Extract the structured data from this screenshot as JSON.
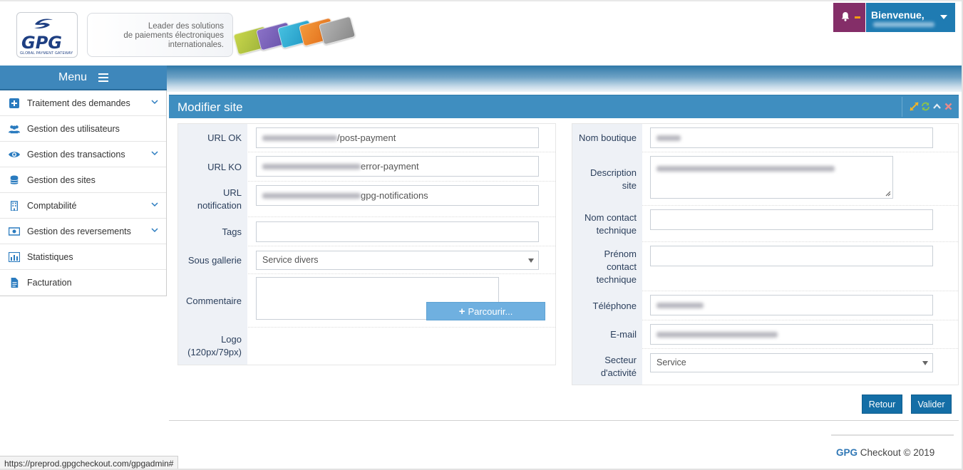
{
  "header": {
    "logo_text": "GPG",
    "logo_sub": "GLOBAL PAYMENT GATEWAY",
    "tagline": [
      "Leader des solutions",
      "de paiements électroniques",
      "internationales."
    ],
    "welcome": "Bienvenue,"
  },
  "menu": {
    "title": "Menu",
    "items": [
      {
        "label": "Traitement des demandes",
        "icon": "plus-square-icon",
        "expandable": true
      },
      {
        "label": "Gestion des utilisateurs",
        "icon": "users-icon",
        "expandable": false
      },
      {
        "label": "Gestion des transactions",
        "icon": "eye-icon",
        "expandable": true
      },
      {
        "label": "Gestion des sites",
        "icon": "database-icon",
        "expandable": false
      },
      {
        "label": "Comptabilité",
        "icon": "building-icon",
        "expandable": true
      },
      {
        "label": "Gestion des reversements",
        "icon": "money-icon",
        "expandable": true
      },
      {
        "label": "Statistiques",
        "icon": "bar-chart-icon",
        "expandable": false
      },
      {
        "label": "Facturation",
        "icon": "file-icon",
        "expandable": false
      }
    ]
  },
  "panel": {
    "title": "Modifier site"
  },
  "left_form": {
    "url_ok": {
      "label": "URL OK",
      "value": "/post-payment"
    },
    "url_ko": {
      "label": "URL KO",
      "value": "error-payment"
    },
    "url_notification": {
      "label_1": "URL",
      "label_2": "notification",
      "value": "gpg-notifications"
    },
    "tags": {
      "label": "Tags",
      "value": ""
    },
    "sous_gallerie": {
      "label": "Sous gallerie",
      "value": "Service divers"
    },
    "commentaire": {
      "label": "Commentaire",
      "value": ""
    },
    "logo": {
      "label_1": "Logo",
      "label_2": "(120px/79px)",
      "button": "Parcourir..."
    }
  },
  "right_form": {
    "nom_boutique": {
      "label": "Nom boutique"
    },
    "description": {
      "label_1": "Description",
      "label_2": "site"
    },
    "nom_contact": {
      "label_1": "Nom contact",
      "label_2": "technique",
      "value": ""
    },
    "prenom_contact": {
      "label_1": "Prénom",
      "label_2": "contact",
      "label_3": "technique",
      "value": ""
    },
    "telephone": {
      "label": "Téléphone"
    },
    "email": {
      "label": "E-mail"
    },
    "secteur": {
      "label_1": "Secteur",
      "label_2": "d'activité",
      "value": "Service"
    }
  },
  "actions": {
    "back": "Retour",
    "submit": "Valider"
  },
  "footer": {
    "brand": "GPG",
    "text": " Checkout © 2019"
  },
  "status_url": "https://preprod.gpgcheckout.com/gpgadmin#",
  "colors": {
    "primary": "#146ea6",
    "panel_header": "#3f8ec0",
    "menu_header": "#3e87bb",
    "notification": "#842e68",
    "label_bg": "#eef1f6"
  }
}
